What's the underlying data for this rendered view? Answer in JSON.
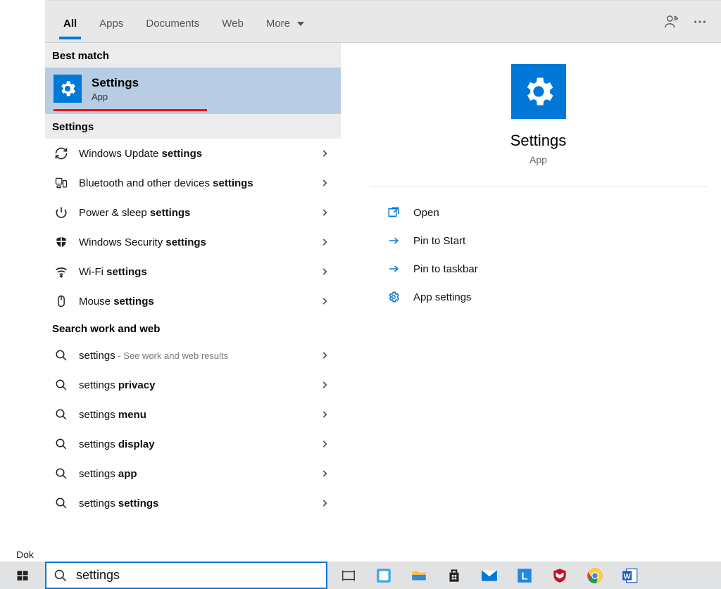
{
  "tabs": {
    "all": "All",
    "apps": "Apps",
    "documents": "Documents",
    "web": "Web",
    "more": "More"
  },
  "sections": {
    "best_match": "Best match",
    "settings": "Settings",
    "search_web": "Search work and web"
  },
  "best_match": {
    "title": "Settings",
    "subtitle": "App"
  },
  "settings_results": [
    {
      "icon": "refresh",
      "pre": "Windows Update ",
      "bold": "settings"
    },
    {
      "icon": "devices",
      "pre": "Bluetooth and other devices ",
      "bold": "settings"
    },
    {
      "icon": "power",
      "pre": "Power & sleep ",
      "bold": "settings"
    },
    {
      "icon": "shield",
      "pre": "Windows Security ",
      "bold": "settings"
    },
    {
      "icon": "wifi",
      "pre": "Wi-Fi ",
      "bold": "settings"
    },
    {
      "icon": "mouse",
      "pre": "Mouse ",
      "bold": "settings"
    }
  ],
  "web_results": [
    {
      "pre": "settings",
      "bold": "",
      "suffix": " - See work and web results"
    },
    {
      "pre": "settings ",
      "bold": "privacy",
      "suffix": ""
    },
    {
      "pre": "settings ",
      "bold": "menu",
      "suffix": ""
    },
    {
      "pre": "settings ",
      "bold": "display",
      "suffix": ""
    },
    {
      "pre": "settings ",
      "bold": "app",
      "suffix": ""
    },
    {
      "pre": "settings ",
      "bold": "settings",
      "suffix": ""
    }
  ],
  "detail": {
    "name": "Settings",
    "type": "App",
    "actions": {
      "open": "Open",
      "pin_start": "Pin to Start",
      "pin_taskbar": "Pin to taskbar",
      "app_settings": "App settings"
    }
  },
  "search_query": "settings",
  "behind_text": "Dok"
}
